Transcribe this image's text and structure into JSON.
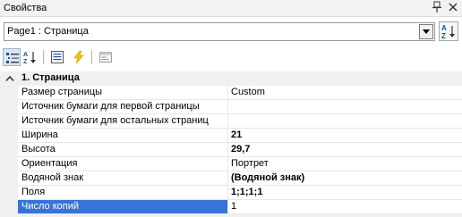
{
  "panel": {
    "title": "Свойства"
  },
  "object_selector": {
    "value": "Page1 : Страница"
  },
  "category": {
    "label": "1. Страница"
  },
  "rows": [
    {
      "name": "Размер страницы",
      "value": "Custom",
      "bold": false
    },
    {
      "name": "Источник бумаги для первой страницы",
      "value": "",
      "bold": false
    },
    {
      "name": "Источник бумаги для остальных страниц",
      "value": "",
      "bold": false
    },
    {
      "name": "Ширина",
      "value": "21",
      "bold": true
    },
    {
      "name": "Высота",
      "value": "29,7",
      "bold": true
    },
    {
      "name": "Ориентация",
      "value": "Портрет",
      "bold": false
    },
    {
      "name": "Водяной знак",
      "value": "(Водяной знак)",
      "bold": true
    },
    {
      "name": "Поля",
      "value": "1;1;1;1",
      "bold": true
    },
    {
      "name": "Число копий",
      "value": "1",
      "bold": false,
      "selected": true
    }
  ],
  "colors": {
    "selection": "#3874d8",
    "category_bg": "#f0f0f0",
    "events_icon": "#f5c400"
  },
  "icons": {
    "pin": "pin-icon",
    "close": "close-icon",
    "dropdown": "chevron-down-icon",
    "sort": "sort-az-icon",
    "categorized": "categorized-icon",
    "alphabetical": "sort-az-icon",
    "properties": "properties-icon",
    "events": "lightning-icon",
    "pages": "property-pages-icon",
    "collapse": "chevron-up-icon"
  }
}
